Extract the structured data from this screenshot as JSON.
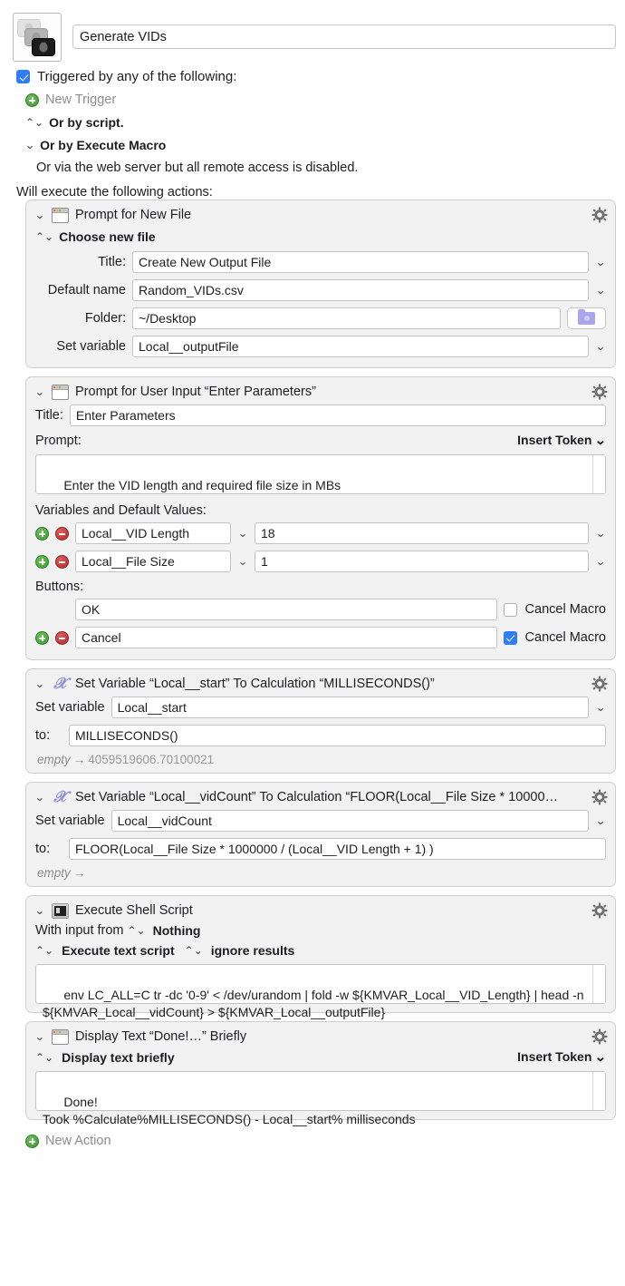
{
  "macro": {
    "icon_name": "macro-stack-icon",
    "name": "Generate VIDs",
    "trigger_checkbox_label": "Triggered by any of the following:",
    "new_trigger_label": "New Trigger",
    "or_by_script_label": "Or by script.",
    "or_by_execute_macro_label": "Or by Execute Macro",
    "web_server_note": "Or via the web server but all remote access is disabled.",
    "will_execute_label": "Will execute the following actions:",
    "new_action_label": "New Action"
  },
  "colors": {
    "accent_blue": "#2f7cf6",
    "add_green": "#3f9a35",
    "remove_red": "#b22c2c",
    "calc_purple": "#8a8ae0",
    "folder_purple": "#a9a6ee",
    "card_bg": "#f2f2f2",
    "card_border": "#cfcfcf"
  },
  "actions": [
    {
      "id": "prompt-for-new-file",
      "icon": "window-icon",
      "title": "Prompt for New File",
      "mode_label": "Choose new file",
      "fields": [
        {
          "label": "Title:",
          "value": "Create New Output File",
          "has_chevron": true
        },
        {
          "label": "Default name",
          "value": "Random_VIDs.csv",
          "has_chevron": true
        },
        {
          "label": "Folder:",
          "value": "~/Desktop",
          "has_chevron": false
        },
        {
          "label": "Set variable",
          "value": "Local__outputFile",
          "has_chevron": true
        }
      ],
      "folder_button_icon": "folder-icon"
    },
    {
      "id": "prompt-for-user-input",
      "icon": "window-icon",
      "title": "Prompt for User Input “Enter Parameters”",
      "title_label": "Title:",
      "title_value": "Enter Parameters",
      "prompt_label": "Prompt:",
      "insert_token_label": "Insert Token",
      "prompt_text": "Enter the VID length and required file size in MBs",
      "variables_label": "Variables and Default Values:",
      "variables": [
        {
          "name": "Local__VID Length",
          "default": "18"
        },
        {
          "name": "Local__File Size",
          "default": "1"
        }
      ],
      "buttons_label": "Buttons:",
      "buttons": [
        {
          "label": "OK",
          "cancel_macro_label": "Cancel Macro",
          "cancel_macro_checked": false,
          "has_addremove": false
        },
        {
          "label": "Cancel",
          "cancel_macro_label": "Cancel Macro",
          "cancel_macro_checked": true,
          "has_addremove": true
        }
      ]
    },
    {
      "id": "set-variable-local-start",
      "icon": "calculation-icon",
      "title": "Set Variable “Local__start” To Calculation “MILLISECONDS()”",
      "set_variable_label": "Set variable",
      "variable_name": "Local__start",
      "to_label": "to:",
      "to_value": "MILLISECONDS()",
      "result_prefix": "empty",
      "result_arrow": "→",
      "result_value": "4059519606.70100021"
    },
    {
      "id": "set-variable-local-vidcount",
      "icon": "calculation-icon",
      "title": "Set Variable “Local__vidCount” To Calculation “FLOOR(Local__File Size * 10000…",
      "set_variable_label": "Set variable",
      "variable_name": "Local__vidCount",
      "to_label": "to:",
      "to_value": "FLOOR(Local__File Size * 1000000 / (Local__VID Length + 1) )",
      "result_prefix": "empty",
      "result_arrow": "→",
      "result_value": ""
    },
    {
      "id": "execute-shell-script",
      "icon": "terminal-icon",
      "title": "Execute Shell Script",
      "input_from_label": "With input from",
      "input_from_value": "Nothing",
      "script_kind": "Execute text script",
      "results_mode": "ignore results",
      "script_text": "env LC_ALL=C tr -dc '0-9' < /dev/urandom | fold -w ${KMVAR_Local__VID_Length} | head -n ${KMVAR_Local__vidCount} > ${KMVAR_Local__outputFile}"
    },
    {
      "id": "display-text-briefly",
      "icon": "window-icon",
      "title": "Display Text “Done!…” Briefly",
      "mode_label": "Display text briefly",
      "insert_token_label": "Insert Token",
      "text": "Done!\nTook %Calculate%MILLISECONDS() - Local__start% milliseconds"
    }
  ]
}
